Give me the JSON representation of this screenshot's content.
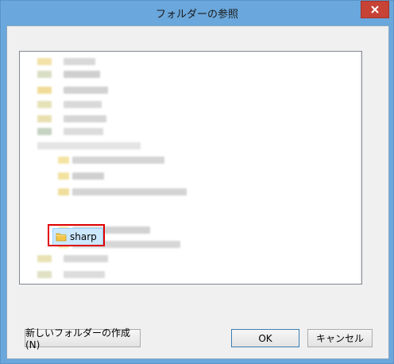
{
  "window": {
    "title": "フォルダーの参照"
  },
  "tree": {
    "selected_label": "sharp"
  },
  "buttons": {
    "new_folder": "新しいフォルダーの作成(N)",
    "ok": "OK",
    "cancel": "キャンセル"
  },
  "colors": {
    "titlebar": "#6aa7dc",
    "close": "#c74336",
    "selection": "#cce8ff",
    "highlight_box": "#e00000"
  },
  "icons": [
    "close-icon",
    "folder-icon",
    "scroll-up-icon",
    "scroll-down-icon"
  ]
}
